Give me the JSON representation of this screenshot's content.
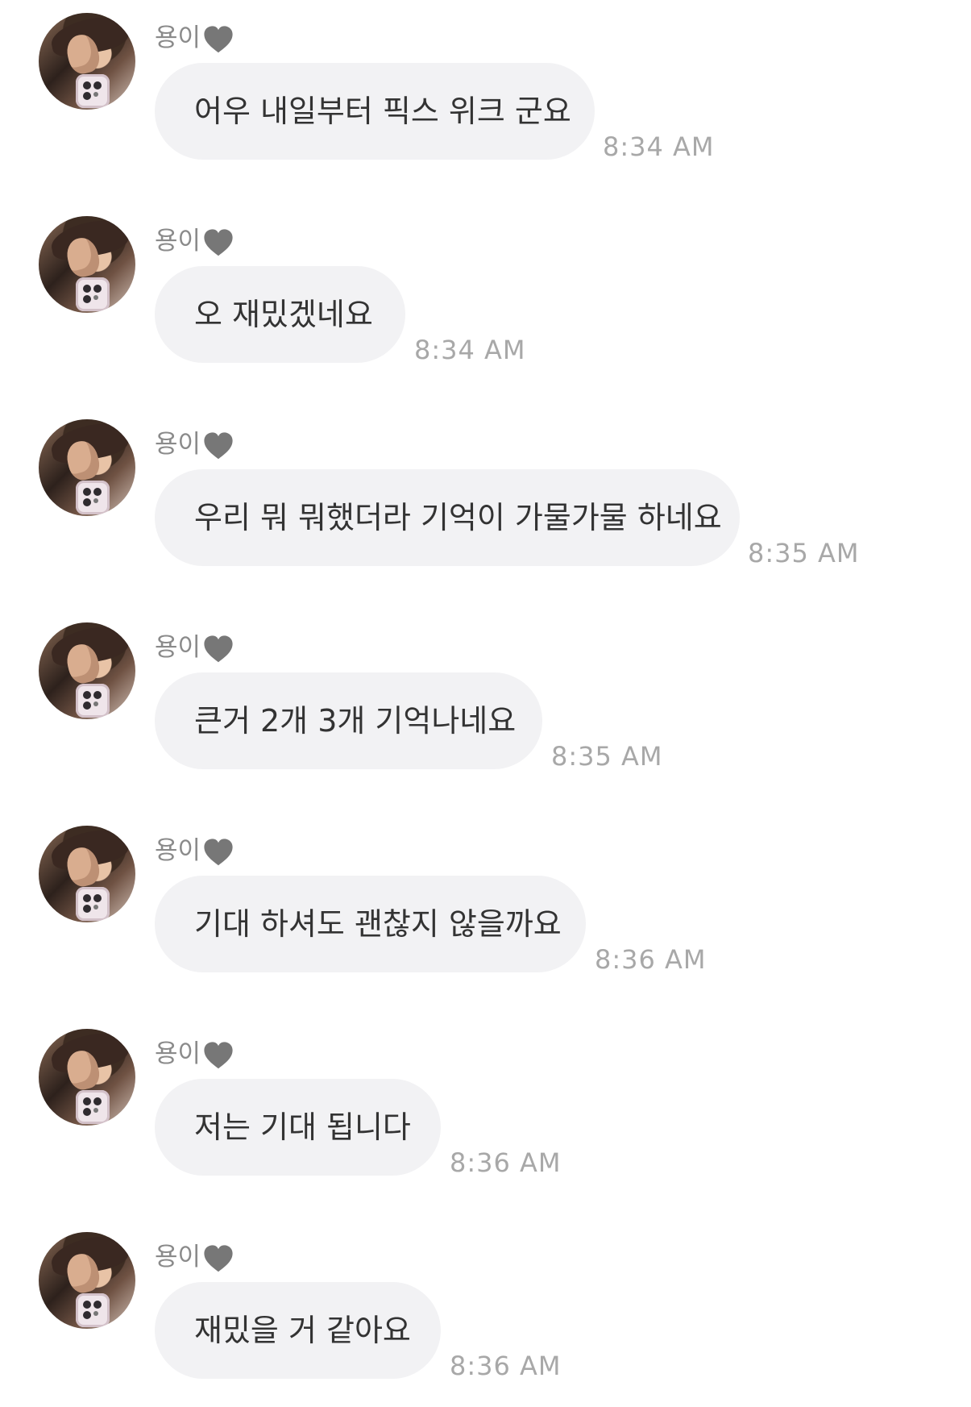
{
  "chat": {
    "messages": [
      {
        "sender": "용이",
        "text": "어우 내일부터 픽스 위크 군요",
        "time": "8:34 AM"
      },
      {
        "sender": "용이",
        "text": "오 재밌겠네요",
        "time": "8:34 AM"
      },
      {
        "sender": "용이",
        "text": "우리 뭐 뭐했더라 기억이 가물가물 하네요",
        "time": "8:35 AM"
      },
      {
        "sender": "용이",
        "text": "큰거 2개 3개 기억나네요",
        "time": "8:35 AM"
      },
      {
        "sender": "용이",
        "text": "기대 하셔도 괜찮지 않을까요",
        "time": "8:36 AM"
      },
      {
        "sender": "용이",
        "text": "저는 기대 됩니다",
        "time": "8:36 AM"
      },
      {
        "sender": "용이",
        "text": "재밌을 거 같아요",
        "time": "8:36 AM"
      }
    ]
  },
  "colors": {
    "bubble": "#f2f2f4",
    "message_text": "#333333",
    "sender_text": "#8a8a8a",
    "time_text": "#a8a8a8",
    "heart": "#777777"
  },
  "icons": {
    "heart": "heart-icon",
    "avatar": "avatar"
  }
}
